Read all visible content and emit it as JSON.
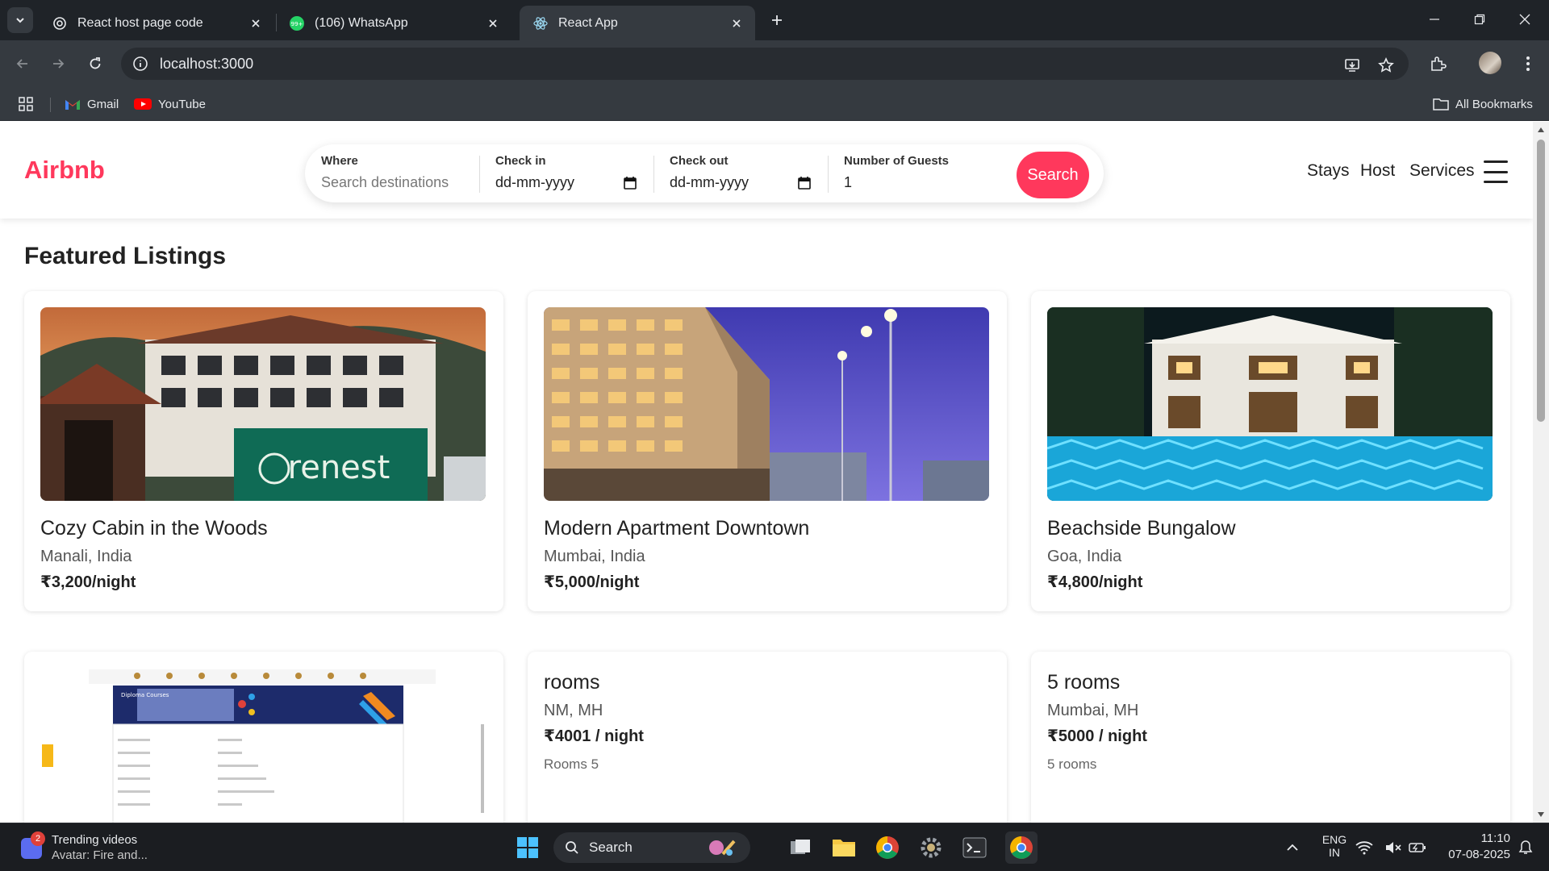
{
  "browser": {
    "tabs": [
      {
        "title": "React host page code",
        "active": false
      },
      {
        "title": "(106) WhatsApp",
        "active": false
      },
      {
        "title": "React App",
        "active": true
      }
    ],
    "url": "localhost:3000",
    "bookmarks": [
      {
        "label": "Gmail"
      },
      {
        "label": "YouTube"
      }
    ],
    "all_bookmarks": "All Bookmarks"
  },
  "site": {
    "logo": "Airbnb",
    "search": {
      "where_label": "Where",
      "where_placeholder": "Search destinations",
      "checkin_label": "Check in",
      "checkin_value": "dd-mm-yyyy",
      "checkout_label": "Check out",
      "checkout_value": "dd-mm-yyyy",
      "guests_label": "Number of Guests",
      "guests_value": "1",
      "button": "Search"
    },
    "nav": [
      "Stays",
      "Host",
      "Services"
    ],
    "section_title": "Featured Listings",
    "listings": [
      {
        "title": "Cozy Cabin in the Woods",
        "location": "Manali, India",
        "price": "₹3,200/night",
        "sign": "renest"
      },
      {
        "title": "Modern Apartment Downtown",
        "location": "Mumbai, India",
        "price": "₹5,000/night"
      },
      {
        "title": "Beachside Bungalow",
        "location": "Goa, India",
        "price": "₹4,800/night"
      },
      {
        "title": "",
        "location": "",
        "price": "",
        "image_heading": "Diploma Courses"
      },
      {
        "title": "rooms",
        "location": "NM, MH",
        "price": "₹4001 / night",
        "description": "Rooms 5"
      },
      {
        "title": "5 rooms",
        "location": "Mumbai, MH",
        "price": "₹5000 / night",
        "description": "5 rooms"
      }
    ]
  },
  "taskbar": {
    "widget_title": "Trending videos",
    "widget_sub": "Avatar: Fire and...",
    "widget_badge": "2",
    "search_label": "Search",
    "lang_top": "ENG",
    "lang_bottom": "IN",
    "time": "11:10",
    "date": "07-08-2025",
    "whatsapp_badge": "99+"
  },
  "colors": {
    "brand": "#ff385c",
    "chrome_dark": "#1f2328",
    "chrome_toolbar": "#353a40"
  }
}
